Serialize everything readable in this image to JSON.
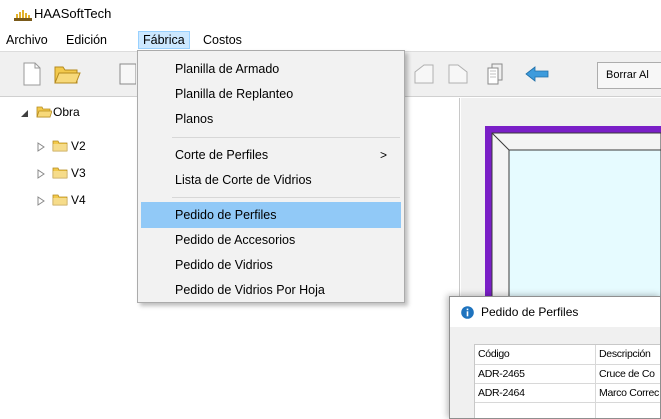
{
  "app": {
    "title": "HAASoftTech"
  },
  "menubar": {
    "items": [
      "Archivo",
      "Edición",
      "Fábrica",
      "Costos"
    ]
  },
  "toolbar": {
    "borrar_label": "Borrar Al"
  },
  "tree": {
    "root": "Obra",
    "children": [
      "V2",
      "V3",
      "V4"
    ]
  },
  "fabrica_menu": {
    "items": [
      "Planilla de Armado",
      "Planilla de Replanteo",
      "Planos",
      "Corte de Perfiles",
      "Lista de Corte de Vidrios",
      "Pedido de Perfiles",
      "Pedido de Accesorios",
      "Pedido de Vidrios",
      "Pedido de Vidrios Por Hoja"
    ],
    "submenu_arrow": ">"
  },
  "dialog": {
    "title": "Pedido de Perfiles",
    "columns": [
      "Código",
      "Descripción"
    ],
    "rows": [
      [
        "ADR-2465",
        "Cruce de Co"
      ],
      [
        "ADR-2464",
        "Marco Correc"
      ]
    ]
  },
  "colors": {
    "menu_highlight": "#91c9f7",
    "active_menu_bg": "#cce8ff",
    "preview_frame": "#7a1fc7",
    "preview_glass": "#e6fbff",
    "folder_yellow": "#f2c94c",
    "info_blue": "#1e73be",
    "back_arrow": "#3d9bdc"
  }
}
